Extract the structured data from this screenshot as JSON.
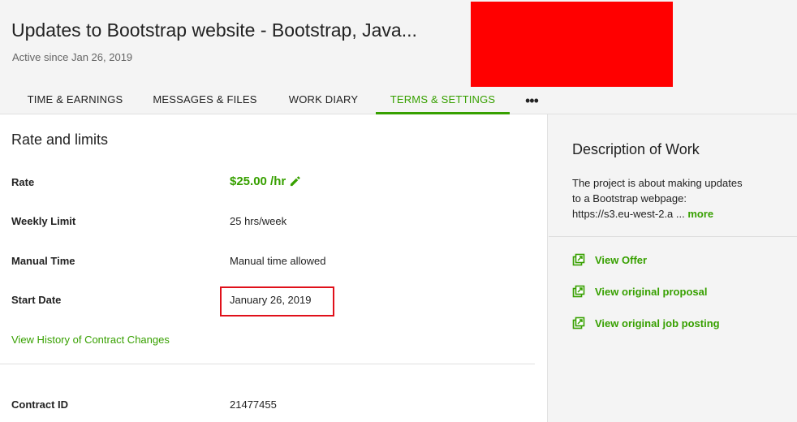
{
  "header": {
    "title": "Updates to Bootstrap website - Bootstrap, Java...",
    "subtitle": "Active since Jan 26, 2019"
  },
  "tabs": [
    {
      "label": "TIME & EARNINGS",
      "active": false
    },
    {
      "label": "MESSAGES & FILES",
      "active": false
    },
    {
      "label": "WORK DIARY",
      "active": false
    },
    {
      "label": "TERMS & SETTINGS",
      "active": true
    }
  ],
  "tab_more_label": "•••",
  "main": {
    "section_title": "Rate and limits",
    "rate_label": "Rate",
    "rate_value": "$25.00 /hr",
    "weekly_label": "Weekly Limit",
    "weekly_value": "25 hrs/week",
    "manual_label": "Manual Time",
    "manual_value": "Manual time allowed",
    "start_label": "Start Date",
    "start_value": "January 26, 2019",
    "history_link": "View History of Contract Changes",
    "contract_label": "Contract ID",
    "contract_value": "21477455"
  },
  "side": {
    "title": "Description of Work",
    "desc_line1": "The project is about making updates",
    "desc_line2": "to a Bootstrap webpage:",
    "desc_line3": "https://s3.eu-west-2.a ...",
    "more_label": "more",
    "links": [
      {
        "label": "View Offer"
      },
      {
        "label": "View original proposal"
      },
      {
        "label": "View original job posting"
      }
    ]
  },
  "colors": {
    "accent": "#37a000",
    "redaction": "#ff0000",
    "highlight": "#e0101a"
  }
}
